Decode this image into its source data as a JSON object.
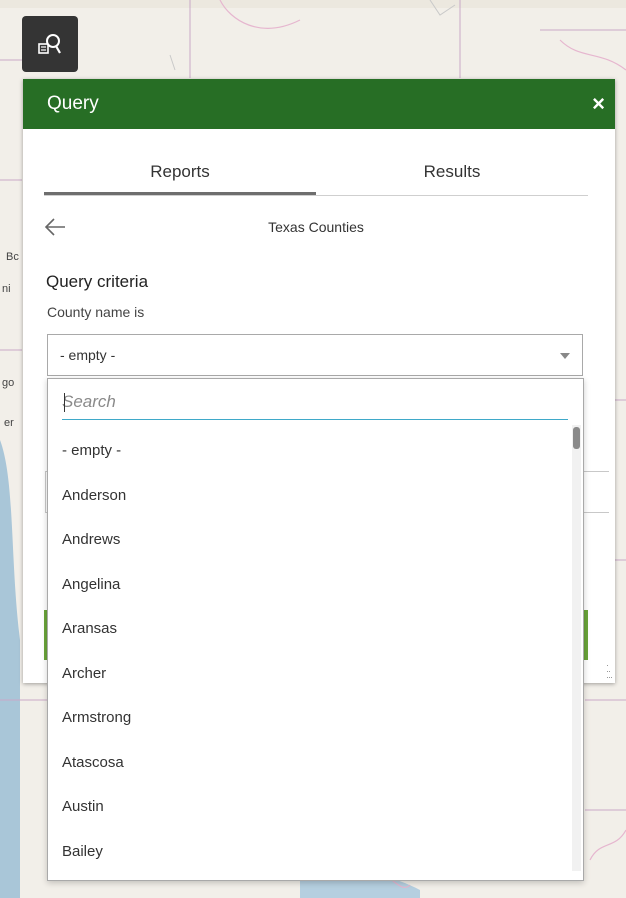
{
  "tool_button": {
    "icon": "query-tool-icon"
  },
  "panel": {
    "title": "Query",
    "close_label": "×",
    "tabs": [
      {
        "label": "Reports",
        "active": true
      },
      {
        "label": "Results",
        "active": false
      }
    ],
    "back_icon": "arrow-left-icon",
    "layer_name": "Texas Counties",
    "criteria_title": "Query criteria",
    "field_label": "County name is",
    "select_value": "- empty -"
  },
  "dropdown": {
    "search_placeholder": "Search",
    "options": [
      "- empty -",
      "Anderson",
      "Andrews",
      "Angelina",
      "Aransas",
      "Archer",
      "Armstrong",
      "Atascosa",
      "Austin",
      "Bailey"
    ]
  },
  "map_labels": [
    "Bc",
    "ni",
    "go",
    "er"
  ],
  "colors": {
    "header_green": "#276e25",
    "accent_green": "#6aa43a",
    "search_underline": "#3fa9c9",
    "tool_button_bg": "#343434"
  }
}
